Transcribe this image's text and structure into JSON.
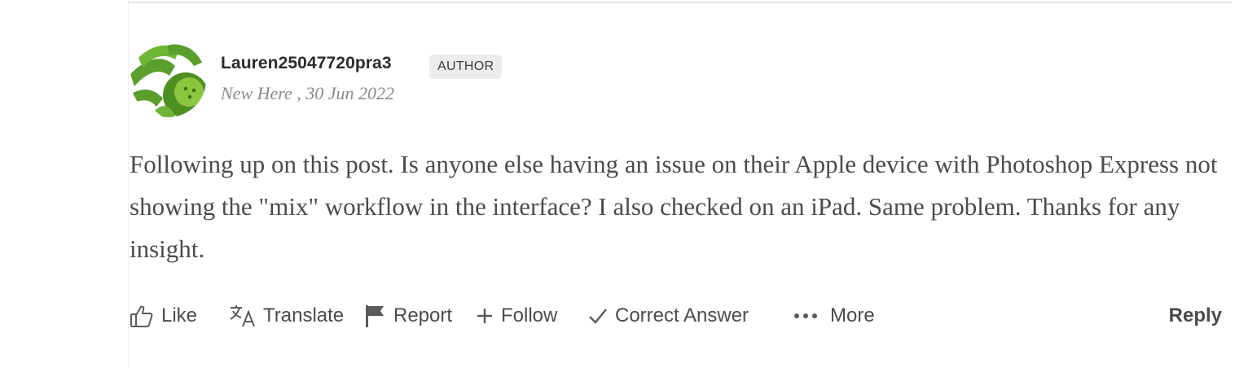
{
  "post": {
    "author": {
      "name": "Lauren25047720pra3",
      "badge": "AUTHOR",
      "meta": "New Here , 30 Jun 2022"
    },
    "body": "Following up on this post. Is anyone else having an issue on their Apple device with Photoshop Express not showing the \"mix\" workflow in the interface? I also checked on an iPad. Same problem. Thanks for any insight.",
    "actions": {
      "like": "Like",
      "translate": "Translate",
      "report": "Report",
      "follow": "Follow",
      "correct_answer": "Correct Answer",
      "more": "More",
      "reply": "Reply"
    }
  },
  "icons": {
    "like": "thumbs-up-icon",
    "translate": "translate-icon",
    "report": "flag-icon",
    "follow": "plus-icon",
    "correct_answer": "checkmark-icon",
    "more": "ellipsis-icon"
  },
  "colors": {
    "avatar_green": "#5a9e2b",
    "avatar_light_green": "#8cc63f",
    "text": "#4b4b4b",
    "meta": "#8a8a8a",
    "badge_bg": "#ececec"
  }
}
